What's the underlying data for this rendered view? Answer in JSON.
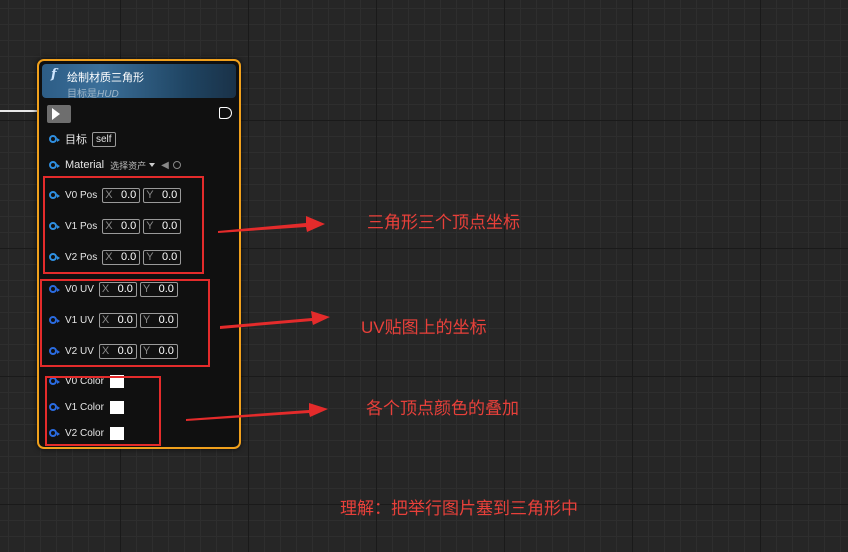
{
  "node": {
    "title": "绘制材质三角形",
    "subtitle_prefix": "目标是",
    "subtitle_target": "HUD",
    "function_icon": "function-f-icon",
    "target_label": "目标",
    "target_value": "self",
    "material_label": "Material",
    "material_select": "选择资产",
    "pos_pins": [
      {
        "label": "V0 Pos",
        "x": "0.0",
        "y": "0.0"
      },
      {
        "label": "V1 Pos",
        "x": "0.0",
        "y": "0.0"
      },
      {
        "label": "V2 Pos",
        "x": "0.0",
        "y": "0.0"
      }
    ],
    "uv_pins": [
      {
        "label": "V0 UV",
        "x": "0.0",
        "y": "0.0"
      },
      {
        "label": "V1 UV",
        "x": "0.0",
        "y": "0.0"
      },
      {
        "label": "V2 UV",
        "x": "0.0",
        "y": "0.0"
      }
    ],
    "color_pins": [
      {
        "label": "V0 Color"
      },
      {
        "label": "V1 Color"
      },
      {
        "label": "V2 Color"
      }
    ],
    "axis_x": "X",
    "axis_y": "Y"
  },
  "annotations": {
    "pos": "三角形三个顶点坐标",
    "uv": "UV贴图上的坐标",
    "color": "各个顶点颜色的叠加",
    "summary": "理解：把举行图片塞到三角形中"
  },
  "colors": {
    "node_border": "#f0a01c",
    "annotation_red": "#e42b2b",
    "pin_blue": "#2f8fe0"
  }
}
